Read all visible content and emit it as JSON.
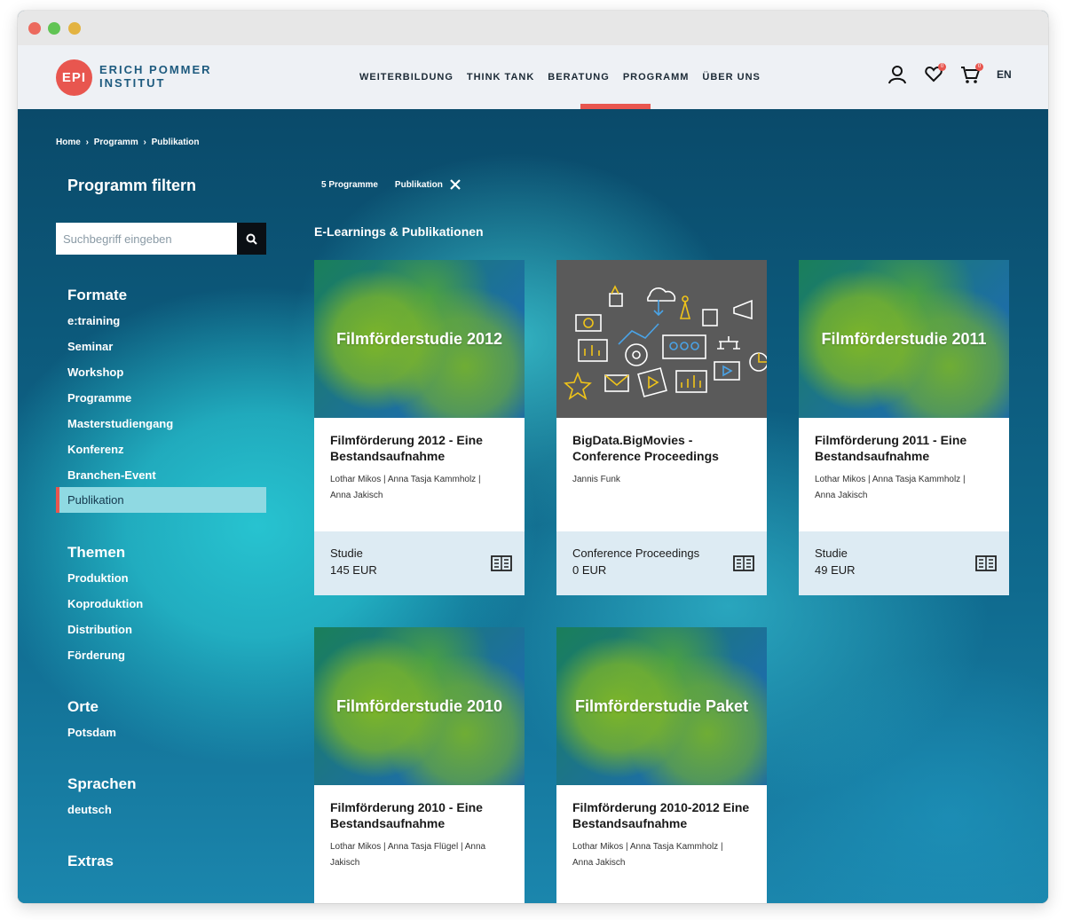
{
  "header": {
    "logo_mark": "EPI",
    "logo_line1": "ERICH POMMER",
    "logo_line2": "INSTITUT",
    "nav": [
      "WEITERBILDUNG",
      "THINK TANK",
      "BERATUNG",
      "PROGRAMM",
      "ÜBER UNS"
    ],
    "active_nav": "PROGRAMM",
    "wishlist_count": "0",
    "cart_count": "0",
    "lang": "EN"
  },
  "breadcrumb": [
    "Home",
    "›",
    "Programm",
    "›",
    "Publikation"
  ],
  "sidebar": {
    "title": "Programm filtern",
    "search_placeholder": "Suchbegriff eingeben",
    "formate_title": "Formate",
    "formate": [
      "e:training",
      "Seminar",
      "Workshop",
      "Programme",
      "Masterstudiengang",
      "Konferenz",
      "Branchen-Event",
      "Publikation"
    ],
    "themen_title": "Themen",
    "themen": [
      "Produktion",
      "Koproduktion",
      "Distribution",
      "Förderung"
    ],
    "orte_title": "Orte",
    "orte": [
      "Potsdam"
    ],
    "sprachen_title": "Sprachen",
    "sprachen": [
      "deutsch"
    ],
    "extras_title": "Extras"
  },
  "filters": {
    "count": "5 Programme",
    "active_chip": "Publikation"
  },
  "section_title": "E-Learnings & Publikationen",
  "cards": [
    {
      "image_title": "Filmförderstudie 2012",
      "title_l1": "Filmförderung 2012 - Eine",
      "title_l2": "Bestandsaufnahme",
      "authors_l1": "Lothar Mikos | Anna Tasja Kammholz |",
      "authors_l2": "Anna Jakisch",
      "type": "Studie",
      "price": "145 EUR"
    },
    {
      "image_title": "",
      "title_l1": "BigData.BigMovies -",
      "title_l2": "Conference Proceedings",
      "authors_l1": "Jannis Funk",
      "authors_l2": "",
      "type": "Conference Proceedings",
      "price": "0 EUR"
    },
    {
      "image_title": "Filmförderstudie 2011",
      "title_l1": "Filmförderung 2011 - Eine",
      "title_l2": "Bestandsaufnahme",
      "authors_l1": "Lothar Mikos | Anna Tasja Kammholz |",
      "authors_l2": "Anna Jakisch",
      "type": "Studie",
      "price": "49 EUR"
    },
    {
      "image_title": "Filmförderstudie 2010",
      "title_l1": "Filmförderung 2010 - Eine",
      "title_l2": "Bestandsaufnahme",
      "authors_l1": "Lothar Mikos | Anna Tasja Flügel | Anna",
      "authors_l2": "Jakisch",
      "type": "",
      "price": ""
    },
    {
      "image_title": "Filmförderstudie Paket",
      "title_l1": "Filmförderung 2010-2012 Eine",
      "title_l2": "Bestandsaufnahme",
      "authors_l1": "Lothar Mikos | Anna Tasja Kammholz |",
      "authors_l2": "Anna Jakisch",
      "type": "",
      "price": ""
    }
  ],
  "colors": {
    "accent": "#e8564f",
    "navy": "#0b4d6e",
    "active_filter_bg": "#8fd9e2",
    "card_footer_bg": "#ddebf3"
  }
}
